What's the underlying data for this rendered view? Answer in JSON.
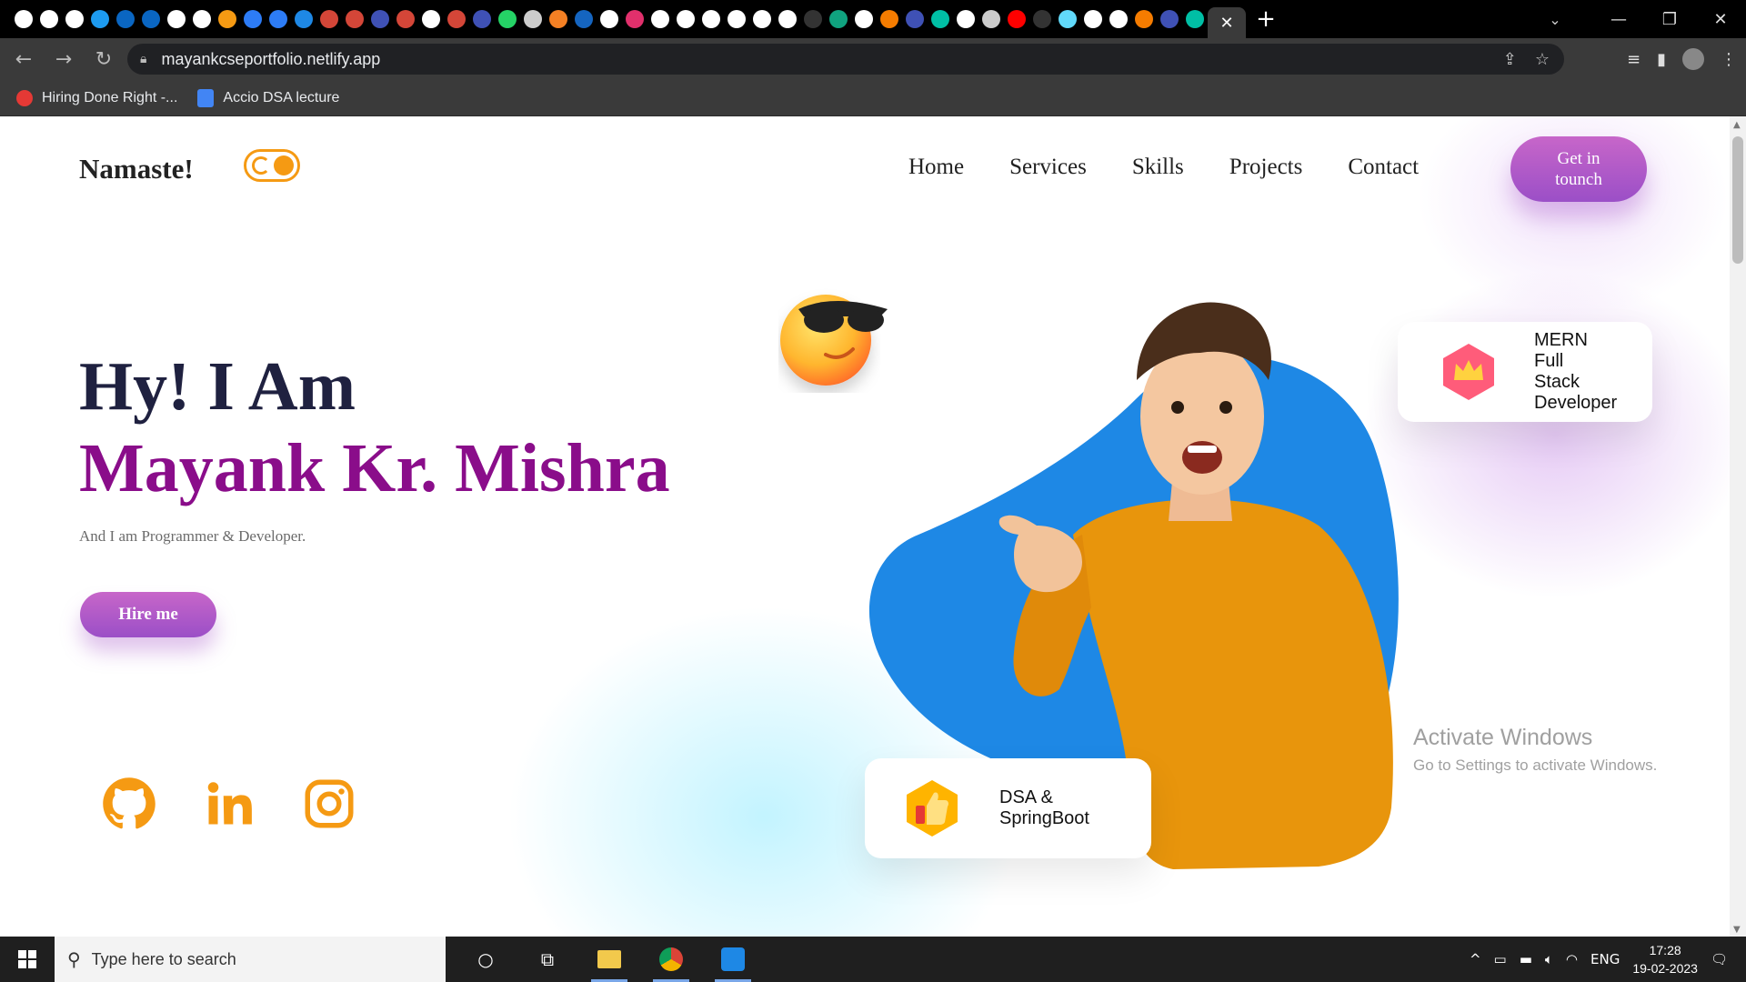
{
  "browser": {
    "tab_close": "✕",
    "new_tab": "+",
    "url": "mayankcseportfolio.netlify.app",
    "bookmarks": [
      {
        "label": "Hiring Done Right -..."
      },
      {
        "label": "Accio DSA lecture"
      }
    ]
  },
  "site": {
    "brand": "Namaste!",
    "nav": [
      "Home",
      "Services",
      "Skills",
      "Projects",
      "Contact"
    ],
    "cta_line1": "Get in",
    "cta_line2": "tounch",
    "hero_line1": "Hy! I Am",
    "hero_name": "Mayank Kr. Mishra",
    "tagline": "And I am Programmer & Developer.",
    "hire_label": "Hire me",
    "card_mern": [
      "MERN",
      "Full",
      "Stack",
      "Developer"
    ],
    "card_dsa": [
      "DSA &",
      "SpringBoot"
    ],
    "colors": {
      "accent": "#8a0d8a",
      "orange": "#f59a13",
      "blob": "#1e88e5",
      "cta": "#b25bc8"
    }
  },
  "watermark": {
    "line1": "Activate Windows",
    "line2": "Go to Settings to activate Windows."
  },
  "taskbar": {
    "search_placeholder": "Type here to search",
    "lang": "ENG",
    "time": "17:28",
    "date": "19-02-2023"
  }
}
